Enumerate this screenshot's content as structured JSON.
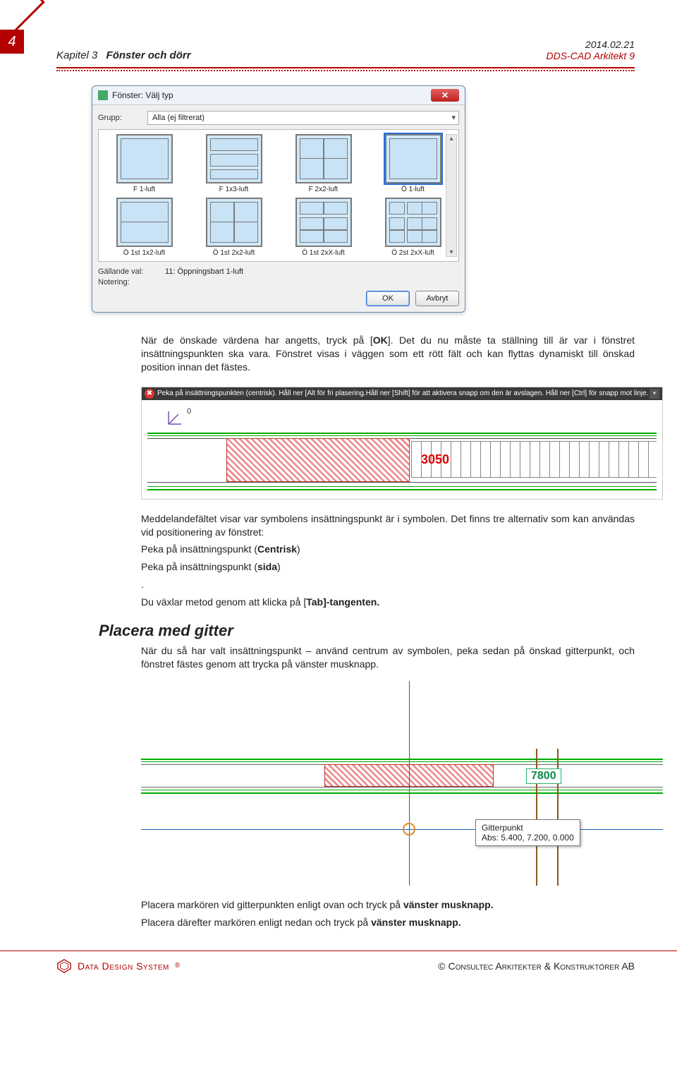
{
  "page_number": "4",
  "header": {
    "chapter": "Kapitel 3",
    "title": "Fönster och dörr",
    "date": "2014.02.21",
    "product": "DDS-CAD Arkitekt 9"
  },
  "dialog": {
    "title": "Fönster: Välj typ",
    "grupp_label": "Grupp:",
    "grupp_value": "Alla (ej filtrerat)",
    "items": [
      "F 1-luft",
      "F 1x3-luft",
      "F 2x2-luft",
      "Ö 1-luft",
      "Ö 1st 1x2-luft",
      "Ö 1st 2x2-luft",
      "Ö 1st 2xX-luft",
      "Ö 2st 2xX-luft"
    ],
    "selected_index": 3,
    "gallande_label": "Gällande val:",
    "gallande_value": "11: Öppningsbart 1-luft",
    "notering_label": "Notering:",
    "ok": "OK",
    "cancel": "Avbryt"
  },
  "para1": {
    "t1": "När de önskade värdena har angetts, tryck på [",
    "ok": "OK",
    "t2": "]. Det du nu måste ta ställning till är var i fönstret insättningspunkten ska vara. Fönstret visas i väggen som ett rött fält och kan flyttas dynamiskt till önskad position innan det fästes."
  },
  "fig1": {
    "instr": "Peka på insättningspunkten (centrisk). Håll ner [Alt  för fri plasering.Håll ner [Shift] för att aktivera snapp om den är avslagen. Håll ner [Ctrl] för snapp mot linje.",
    "dim": "3050",
    "zero": "0"
  },
  "para2": {
    "t1": "Meddelandefältet visar var symbolens insättningspunkt är i symbolen. Det finns tre alternativ som kan användas vid positionering av fönstret:",
    "l1a": "Peka på insättningspunkt (",
    "l1b": "Centrisk",
    "l1c": ")",
    "l2a": "Peka på insättningspunkt (",
    "l2b": "sida",
    "l2c": ")",
    "dot": ".",
    "t2a": "Du växlar metod genom att klicka på [",
    "t2b": "Tab]-tangenten."
  },
  "heading2": "Placera med gitter",
  "para3": "När du så har valt insättningspunkt – använd centrum av symbolen, peka sedan på önskad gitterpunkt, och fönstret fästes genom att trycka på vänster musknapp.",
  "fig2": {
    "dim": "7800",
    "tip_title": "Gitterpunkt",
    "tip_abs": "Abs: 5.400, 7.200, 0.000"
  },
  "para4": {
    "t1": "Placera markören vid gitterpunkten enligt ovan och tryck på ",
    "b1": "vänster musknapp.",
    "t2": "Placera därefter markören enligt nedan och tryck på ",
    "b2": "vänster musknapp."
  },
  "footer": {
    "brand": "Data Design System",
    "reg": "®",
    "copy": "©  Consultec Arkitekter & Konstruktörer AB"
  }
}
